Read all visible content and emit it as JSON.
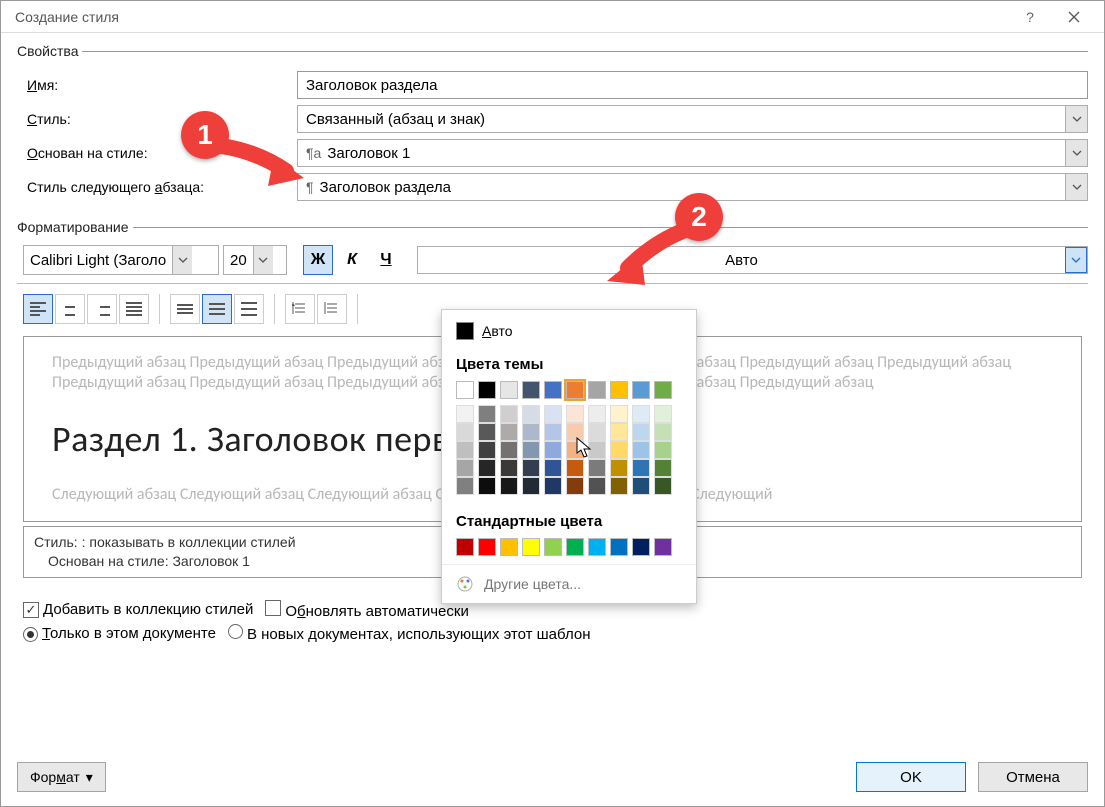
{
  "window": {
    "title": "Создание стиля"
  },
  "sections": {
    "properties": "Свойства",
    "formatting": "Форматирование"
  },
  "labels": {
    "name": "Имя:",
    "style": "Стиль:",
    "based_on": "Основан на стиле:",
    "next_style": "Стиль следующего абзаца:"
  },
  "values": {
    "name": "Заголовок раздела",
    "style_type": "Связанный (абзац и знак)",
    "based_on": "Заголовок 1",
    "next_style": "Заголовок раздела",
    "font_name": "Calibri Light (Заголо",
    "font_size": "20",
    "font_color": "Авто",
    "bold": "Ж",
    "italic": "К",
    "underline": "Ч"
  },
  "preview": {
    "prev_para": "Предыдущий абзац Предыдущий абзац Предыдущий абзац Предыдущий абзац Предыдущий абзац Предыдущий абзац Предыдущий абзац Предыдущий абзац Предыдущий абзац Предыдущий абзац Предыдущий абзац Предыдущий абзац Предыдущий абзац",
    "sample": "Раздел 1. Заголовок первого раздела",
    "next_para": "Следующий абзац Следующий абзац Следующий абзац Следующий абзац Следующий абзац Следующий"
  },
  "description": {
    "line1": "Стиль: : показывать в коллекции стилей",
    "line2": "Основан на стиле: Заголовок 1"
  },
  "checks": {
    "add_gallery": "Добавить в коллекцию стилей",
    "auto_update": "Обновлять автоматически",
    "this_doc": "Только в этом документе",
    "new_docs": "В новых документах, использующих этот шаблон"
  },
  "buttons": {
    "format": "Формат",
    "ok": "OK",
    "cancel": "Отмена"
  },
  "colorpop": {
    "auto": "Авто",
    "theme": "Цвета темы",
    "standard": "Стандартные цвета",
    "more": "Другие цвета...",
    "theme_row": [
      "#ffffff",
      "#000000",
      "#e7e6e6",
      "#44546a",
      "#4472c4",
      "#ed7d31",
      "#a5a5a5",
      "#ffc000",
      "#5b9bd5",
      "#70ad47"
    ],
    "shades": [
      [
        "#f2f2f2",
        "#d9d9d9",
        "#bfbfbf",
        "#a6a6a6",
        "#808080"
      ],
      [
        "#7f7f7f",
        "#595959",
        "#404040",
        "#262626",
        "#0d0d0d"
      ],
      [
        "#d0cece",
        "#aeaaaa",
        "#767171",
        "#3b3838",
        "#181717"
      ],
      [
        "#d6dce5",
        "#adb9ca",
        "#8497b0",
        "#333f50",
        "#222a35"
      ],
      [
        "#d9e1f2",
        "#b4c6e7",
        "#8ea9db",
        "#2f5597",
        "#1f3864"
      ],
      [
        "#fbe5d6",
        "#f8cbad",
        "#f4b183",
        "#c55a11",
        "#843c0c"
      ],
      [
        "#ededed",
        "#dbdbdb",
        "#c9c9c9",
        "#7b7b7b",
        "#525252"
      ],
      [
        "#fff2cc",
        "#ffe699",
        "#ffd966",
        "#bf9000",
        "#806000"
      ],
      [
        "#deebf7",
        "#bdd7ee",
        "#9dc3e6",
        "#2e75b6",
        "#1f4e79"
      ],
      [
        "#e2efda",
        "#c5e0b4",
        "#a9d18e",
        "#548235",
        "#385724"
      ]
    ],
    "standard_row": [
      "#c00000",
      "#ff0000",
      "#ffc000",
      "#ffff00",
      "#92d050",
      "#00b050",
      "#00b0f0",
      "#0070c0",
      "#002060",
      "#7030a0"
    ]
  },
  "annotations": {
    "1": "1",
    "2": "2"
  }
}
